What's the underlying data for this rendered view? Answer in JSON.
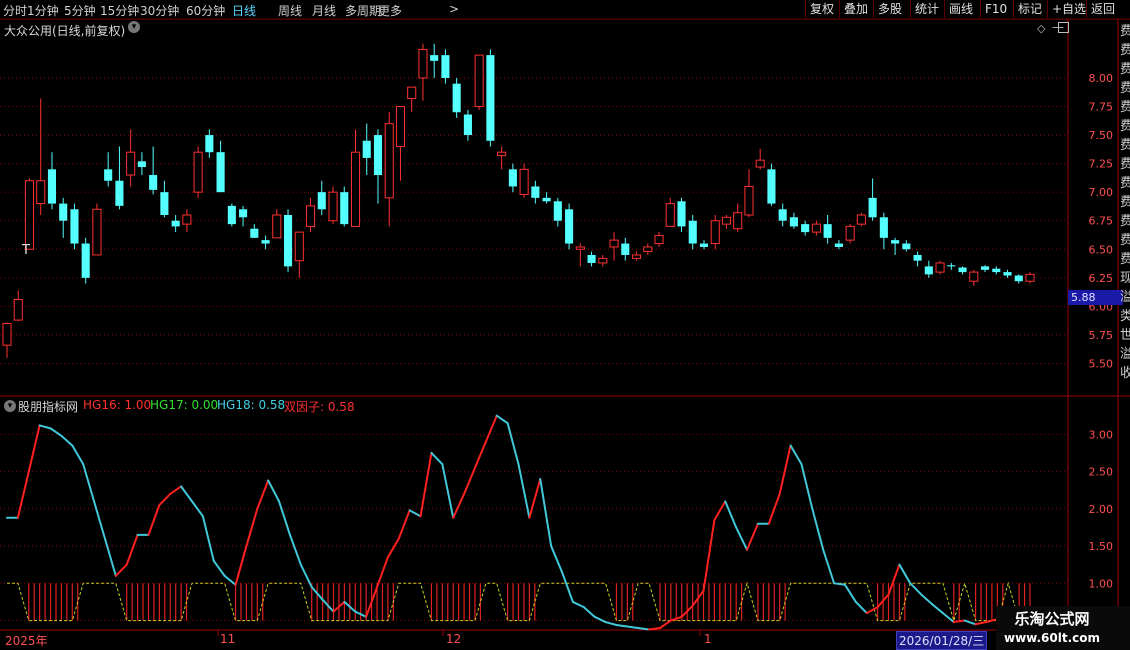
{
  "toolbar": {
    "periods": [
      "分时",
      "1分钟",
      "5分钟",
      "15分钟",
      "30分钟",
      "60分钟",
      "日线",
      "周线",
      "月线",
      "多周期",
      "更多"
    ],
    "active_period": "日线",
    "right_buttons": [
      "复权",
      "叠加",
      "多股",
      "统计",
      "画线",
      "F10",
      "标记",
      "+自选",
      "返回"
    ]
  },
  "main_panel": {
    "title": "大众公用(日线,前复权)",
    "price_marker": "5.88",
    "left_marker": "T"
  },
  "indicator_panel": {
    "title": "股朋指标网",
    "items": [
      {
        "label": "HG16: 1.00",
        "color": "#ff3030"
      },
      {
        "label": "HG17: 0.00",
        "color": "#30e030"
      },
      {
        "label": "HG18: 0.58",
        "color": "#40d0e0"
      },
      {
        "label": "双因子: 0.58",
        "color": "#ff3030"
      }
    ]
  },
  "date_axis": {
    "labels": [
      "2025年",
      "11",
      "12",
      "1"
    ],
    "current_date": "2026/01/28/三"
  },
  "right_strip_chars": "费费费费费费费费费费费费费现溢类世溢收",
  "watermark": {
    "title": "乐淘公式网",
    "url": "www.60lt.com"
  },
  "colors": {
    "up": "#ff3030",
    "down": "#54ffff",
    "grid": "#8a0000",
    "axis_text": "#ff5050",
    "blue_line": "#40c8d8"
  },
  "chart_data": [
    {
      "type": "candlestick",
      "title": "大众公用(日线,前复权)",
      "y_ticks": [
        5.5,
        5.75,
        6.0,
        6.25,
        6.5,
        6.75,
        7.0,
        7.25,
        7.5,
        7.75,
        8.0
      ],
      "ylim": [
        5.25,
        8.35
      ],
      "last_price": 5.88,
      "candles": [
        [
          5.66,
          5.85,
          5.55,
          5.86
        ],
        [
          5.88,
          6.06,
          5.87,
          6.14
        ],
        [
          6.5,
          7.1,
          6.5,
          7.12
        ],
        [
          6.9,
          7.1,
          6.8,
          7.82
        ],
        [
          7.2,
          6.9,
          6.85,
          7.35
        ],
        [
          6.9,
          6.75,
          6.6,
          6.95
        ],
        [
          6.85,
          6.55,
          6.5,
          6.9
        ],
        [
          6.55,
          6.25,
          6.2,
          6.6
        ],
        [
          6.45,
          6.85,
          6.45,
          6.9
        ],
        [
          7.2,
          7.1,
          7.05,
          7.35
        ],
        [
          7.1,
          6.88,
          6.85,
          7.4
        ],
        [
          7.15,
          7.35,
          7.05,
          7.55
        ],
        [
          7.27,
          7.22,
          7.15,
          7.35
        ],
        [
          7.15,
          7.02,
          6.98,
          7.4
        ],
        [
          7.0,
          6.8,
          6.78,
          7.1
        ],
        [
          6.75,
          6.7,
          6.65,
          6.8
        ],
        [
          6.72,
          6.8,
          6.65,
          6.85
        ],
        [
          7.0,
          7.35,
          6.95,
          7.4
        ],
        [
          7.5,
          7.35,
          7.3,
          7.55
        ],
        [
          7.35,
          7.0,
          7.0,
          7.45
        ],
        [
          6.88,
          6.72,
          6.7,
          6.9
        ],
        [
          6.85,
          6.78,
          6.7,
          6.88
        ],
        [
          6.68,
          6.6,
          6.6,
          6.72
        ],
        [
          6.58,
          6.55,
          6.5,
          6.62
        ],
        [
          6.6,
          6.8,
          6.6,
          6.85
        ],
        [
          6.8,
          6.35,
          6.3,
          6.85
        ],
        [
          6.4,
          6.65,
          6.25,
          6.65
        ],
        [
          6.7,
          6.88,
          6.65,
          6.95
        ],
        [
          7.0,
          6.85,
          6.8,
          7.1
        ],
        [
          6.75,
          7.0,
          6.72,
          7.05
        ],
        [
          7.0,
          6.72,
          6.7,
          7.05
        ],
        [
          6.7,
          7.35,
          6.7,
          7.55
        ],
        [
          7.45,
          7.3,
          7.15,
          7.6
        ],
        [
          7.5,
          7.15,
          6.9,
          7.55
        ],
        [
          6.95,
          7.6,
          6.7,
          7.7
        ],
        [
          7.4,
          7.75,
          7.1,
          7.7
        ],
        [
          7.82,
          7.92,
          7.7,
          7.9
        ],
        [
          8.0,
          8.25,
          7.8,
          8.3
        ],
        [
          8.2,
          8.15,
          8.0,
          8.3
        ],
        [
          8.2,
          8.0,
          7.95,
          8.25
        ],
        [
          7.95,
          7.7,
          7.65,
          8.0
        ],
        [
          7.68,
          7.5,
          7.45,
          7.72
        ],
        [
          7.75,
          8.2,
          7.72,
          8.2
        ],
        [
          8.2,
          7.45,
          7.4,
          8.25
        ],
        [
          7.32,
          7.35,
          7.2,
          7.4
        ],
        [
          7.2,
          7.05,
          7.0,
          7.25
        ],
        [
          6.98,
          7.2,
          6.95,
          7.25
        ],
        [
          7.05,
          6.95,
          6.9,
          7.1
        ],
        [
          6.95,
          6.92,
          6.9,
          7.0
        ],
        [
          6.92,
          6.75,
          6.7,
          6.95
        ],
        [
          6.85,
          6.55,
          6.5,
          6.9
        ],
        [
          6.5,
          6.52,
          6.35,
          6.55
        ],
        [
          6.45,
          6.38,
          6.35,
          6.48
        ],
        [
          6.38,
          6.42,
          6.35,
          6.45
        ],
        [
          6.52,
          6.58,
          6.4,
          6.65
        ],
        [
          6.55,
          6.45,
          6.4,
          6.6
        ],
        [
          6.42,
          6.45,
          6.4,
          6.48
        ],
        [
          6.48,
          6.52,
          6.45,
          6.55
        ],
        [
          6.55,
          6.62,
          6.52,
          6.65
        ],
        [
          6.7,
          6.9,
          6.7,
          6.95
        ],
        [
          6.92,
          6.7,
          6.65,
          6.95
        ],
        [
          6.75,
          6.55,
          6.5,
          6.8
        ],
        [
          6.55,
          6.52,
          6.5,
          6.58
        ],
        [
          6.55,
          6.75,
          6.5,
          6.8
        ],
        [
          6.72,
          6.78,
          6.68,
          6.8
        ],
        [
          6.68,
          6.82,
          6.65,
          6.9
        ],
        [
          6.8,
          7.05,
          6.78,
          7.2
        ],
        [
          7.22,
          7.28,
          7.2,
          7.38
        ],
        [
          7.2,
          6.9,
          6.88,
          7.25
        ],
        [
          6.85,
          6.75,
          6.7,
          6.9
        ],
        [
          6.78,
          6.7,
          6.68,
          6.82
        ],
        [
          6.72,
          6.65,
          6.62,
          6.75
        ],
        [
          6.65,
          6.72,
          6.62,
          6.75
        ],
        [
          6.72,
          6.6,
          6.55,
          6.8
        ],
        [
          6.55,
          6.52,
          6.5,
          6.58
        ],
        [
          6.58,
          6.7,
          6.55,
          6.72
        ],
        [
          6.72,
          6.8,
          6.7,
          6.82
        ],
        [
          6.95,
          6.78,
          6.75,
          7.12
        ],
        [
          6.78,
          6.6,
          6.5,
          6.82
        ],
        [
          6.58,
          6.55,
          6.45,
          6.6
        ],
        [
          6.55,
          6.5,
          6.48,
          6.58
        ],
        [
          6.45,
          6.4,
          6.35,
          6.48
        ],
        [
          6.35,
          6.28,
          6.25,
          6.4
        ],
        [
          6.3,
          6.38,
          6.28,
          6.4
        ],
        [
          6.36,
          6.35,
          6.32,
          6.38
        ],
        [
          6.34,
          6.3,
          6.28,
          6.35
        ],
        [
          6.22,
          6.3,
          6.18,
          6.32
        ],
        [
          6.35,
          6.32,
          6.3,
          6.36
        ],
        [
          6.33,
          6.3,
          6.28,
          6.35
        ],
        [
          6.3,
          6.27,
          6.25,
          6.32
        ],
        [
          6.27,
          6.22,
          6.2,
          6.28
        ],
        [
          6.22,
          6.28,
          6.2,
          6.3
        ]
      ]
    },
    {
      "type": "line",
      "title": "股朋指标网",
      "y_ticks": [
        0.5,
        1.0,
        1.5,
        2.0,
        2.5,
        3.0
      ],
      "ylim": [
        0.4,
        3.3
      ],
      "series": [
        {
          "name": "HG18",
          "values": [
            1.88,
            1.88,
            2.5,
            3.12,
            3.08,
            2.98,
            2.85,
            2.6,
            2.1,
            1.6,
            1.1,
            1.25,
            1.65,
            1.65,
            2.05,
            2.2,
            2.3,
            2.1,
            1.9,
            1.3,
            1.1,
            0.98,
            1.5,
            2.0,
            2.38,
            2.1,
            1.65,
            1.25,
            0.95,
            0.78,
            0.62,
            0.75,
            0.62,
            0.55,
            0.95,
            1.35,
            1.6,
            1.98,
            1.9,
            2.75,
            2.6,
            1.88,
            2.2,
            2.55,
            2.9,
            3.25,
            3.15,
            2.6,
            1.88,
            2.4,
            1.5,
            1.15,
            0.75,
            0.68,
            0.55,
            0.48,
            0.44,
            0.42,
            0.4,
            0.38,
            0.4,
            0.5,
            0.55,
            0.7,
            0.9,
            1.85,
            2.1,
            1.75,
            1.45,
            1.8,
            1.8,
            2.2,
            2.85,
            2.6,
            2.0,
            1.45,
            1.0,
            0.98,
            0.75,
            0.6,
            0.68,
            0.85,
            1.25,
            1.0,
            0.85,
            0.72,
            0.6,
            0.48,
            0.5,
            0.45,
            0.48,
            0.52,
            0.48,
            0.55,
            0.6
          ]
        },
        {
          "name": "HG17",
          "values": [
            1.0,
            1.0,
            0.5,
            0.5,
            0.5,
            0.5,
            0.5,
            1.0,
            1.0,
            1.0,
            1.0,
            0.5,
            0.5,
            0.5,
            0.5,
            0.5,
            0.5,
            1.0,
            1.0,
            1.0,
            1.0,
            0.5,
            0.5,
            0.5,
            1.0,
            1.0,
            1.0,
            1.0,
            0.5,
            0.5,
            0.5,
            0.5,
            0.5,
            0.5,
            0.5,
            0.5,
            1.0,
            1.0,
            1.0,
            0.5,
            0.5,
            0.5,
            0.5,
            0.5,
            1.0,
            1.0,
            0.5,
            0.5,
            0.5,
            1.0,
            1.0,
            1.0,
            1.0,
            1.0,
            1.0,
            1.0,
            0.5,
            0.5,
            1.0,
            1.0,
            0.5,
            0.5,
            0.5,
            0.5,
            0.5,
            0.5,
            0.5,
            0.5,
            1.0,
            0.5,
            0.5,
            0.5,
            1.0,
            1.0,
            1.0,
            1.0,
            1.0,
            1.0,
            1.0,
            1.0,
            0.5,
            0.5,
            0.5,
            1.0,
            1.0,
            1.0,
            1.0,
            0.5,
            1.0,
            0.5,
            0.5,
            0.5,
            1.0,
            0.5,
            0.5
          ]
        }
      ]
    }
  ]
}
